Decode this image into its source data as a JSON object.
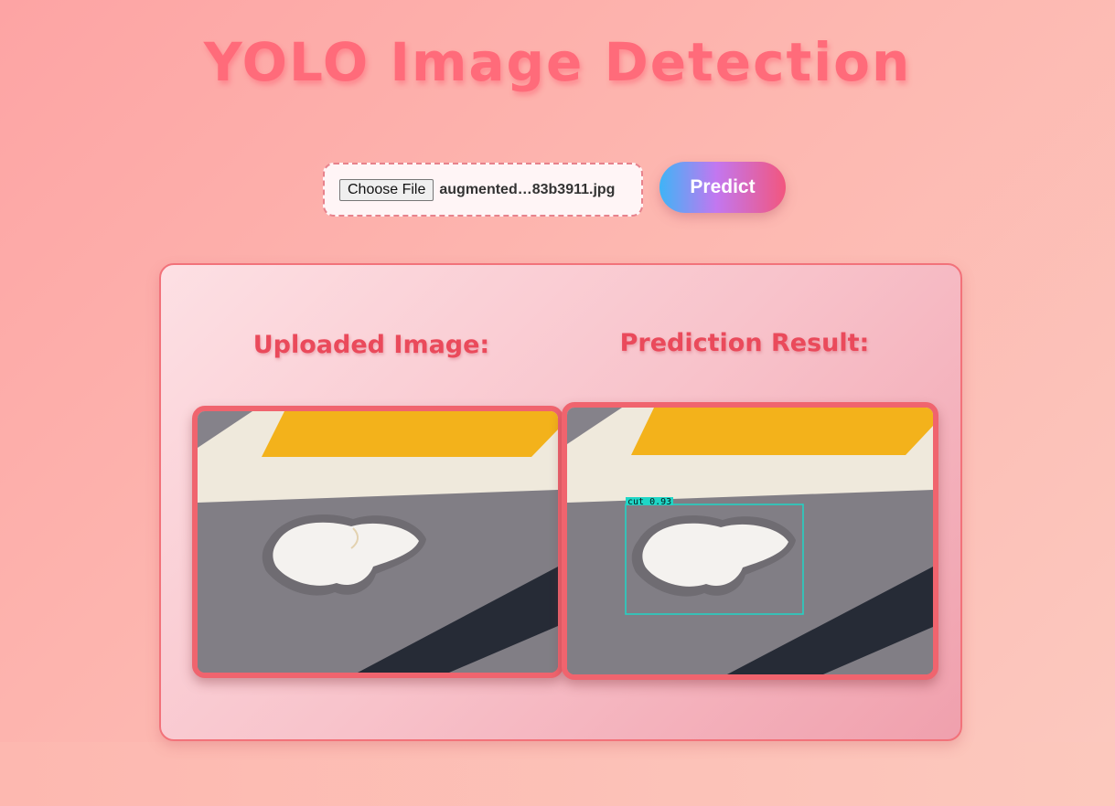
{
  "header": {
    "title": "YOLO Image Detection"
  },
  "upload": {
    "choose_label": "Choose File",
    "file_name": "augmented…83b3911.jpg",
    "predict_label": "Predict"
  },
  "results": {
    "uploaded_title": "Uploaded Image:",
    "prediction_title": "Prediction Result:",
    "detection": {
      "label": "cut",
      "confidence": "0.93",
      "text": "cut 0.93"
    }
  },
  "colors": {
    "accent": "#ff6b7a",
    "frame": "#f0646e",
    "box": "#1fd6c6"
  }
}
